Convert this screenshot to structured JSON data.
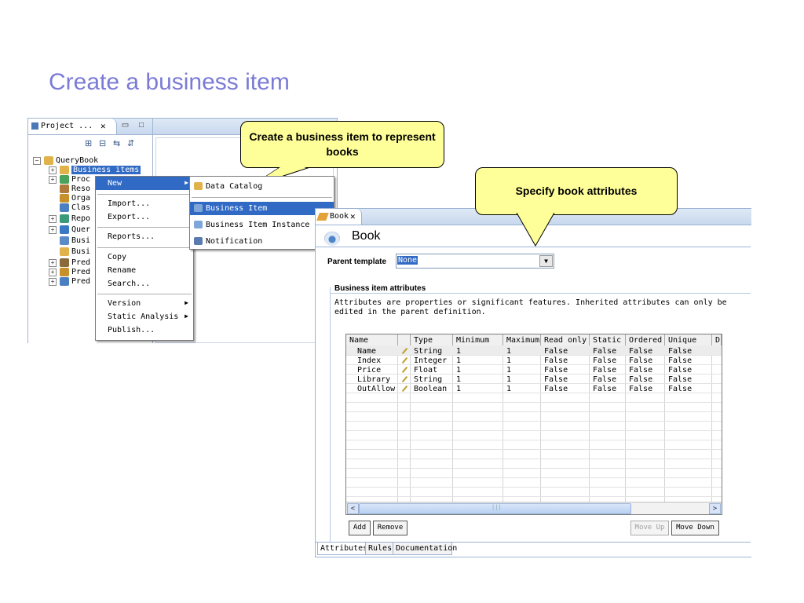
{
  "slide": {
    "title": "Create a business item"
  },
  "explorer": {
    "tab_label": "Project ...",
    "close_glyph": "✕",
    "window_buttons": "▭ □",
    "tree": [
      {
        "label": "QueryBook",
        "expander": "−",
        "color": "#e2b24a"
      },
      {
        "label": "Business items",
        "expander": "+",
        "color": "#e2b24a"
      },
      {
        "label": "Proc",
        "expander": "+",
        "color": "#4aa35a"
      },
      {
        "label": "Reso",
        "expander": "",
        "color": "#b07a3a"
      },
      {
        "label": "Orga",
        "expander": "",
        "color": "#c8902a"
      },
      {
        "label": "Clas",
        "expander": "",
        "color": "#4b7fc4"
      },
      {
        "label": "Repo",
        "expander": "+",
        "color": "#3a9a7a"
      },
      {
        "label": "Quer",
        "expander": "+",
        "color": "#3a7ac4"
      },
      {
        "label": "Busi",
        "expander": "",
        "color": "#5a8ac8"
      },
      {
        "label": "Busi",
        "expander": "",
        "color": "#e2b24a"
      },
      {
        "label": "Pred",
        "expander": "+",
        "color": "#8a6a3a"
      },
      {
        "label": "Pred",
        "expander": "+",
        "color": "#c8902a"
      },
      {
        "label": "Pred",
        "expander": "+",
        "color": "#4b7fc4"
      }
    ]
  },
  "context_menu": {
    "items": [
      {
        "label": "New",
        "arrow": "▶"
      },
      {
        "label": "Import..."
      },
      {
        "label": "Export..."
      },
      {
        "label": "Reports..."
      },
      {
        "label": "Copy"
      },
      {
        "label": "Rename"
      },
      {
        "label": "Search..."
      },
      {
        "label": "Version",
        "arrow": "▶"
      },
      {
        "label": "Static Analysis",
        "arrow": "▶"
      },
      {
        "label": "Publish..."
      }
    ]
  },
  "submenu": {
    "items": [
      {
        "label": "Data Catalog",
        "color": "#e2b24a"
      },
      {
        "label": "Business Item",
        "color": "#7fa6d8"
      },
      {
        "label": "Business Item Instance",
        "color": "#7fa6d8"
      },
      {
        "label": "Notification",
        "color": "#5a7ab0"
      }
    ]
  },
  "callouts": {
    "create": "Create a business item to represent books",
    "specify": "Specify book attributes"
  },
  "book_editor": {
    "tab_label": "Book",
    "close_glyph": "✕",
    "title": "Book",
    "parent_template_label": "Parent template",
    "parent_template_value": "None",
    "dropdown_glyph": "▼",
    "section_title": "Business item attributes",
    "section_description": "Attributes are properties or significant features. Inherited attributes can only be edited in the parent definition.",
    "table": {
      "columns": [
        "Name",
        "",
        "Type",
        "Minimum",
        "Maximum",
        "Read only",
        "Static",
        "Ordered",
        "Unique",
        "D"
      ],
      "rows": [
        [
          "Name",
          "String",
          "1",
          "1",
          "False",
          "False",
          "False",
          "False"
        ],
        [
          "Index",
          "Integer",
          "1",
          "1",
          "False",
          "False",
          "False",
          "False"
        ],
        [
          "Price",
          "Float",
          "1",
          "1",
          "False",
          "False",
          "False",
          "False"
        ],
        [
          "Library",
          "String",
          "1",
          "1",
          "False",
          "False",
          "False",
          "False"
        ],
        [
          "OutAllow",
          "Boolean",
          "1",
          "1",
          "False",
          "False",
          "False",
          "False"
        ]
      ],
      "scroll_left": "<",
      "scroll_right": ">",
      "scroll_grip": "|||"
    },
    "buttons": {
      "add": "Add",
      "remove": "Remove",
      "move_up": "Move Up",
      "move_down": "Move Down"
    },
    "bottom_tabs": [
      "Attributes",
      "Rules",
      "Documentation"
    ]
  }
}
